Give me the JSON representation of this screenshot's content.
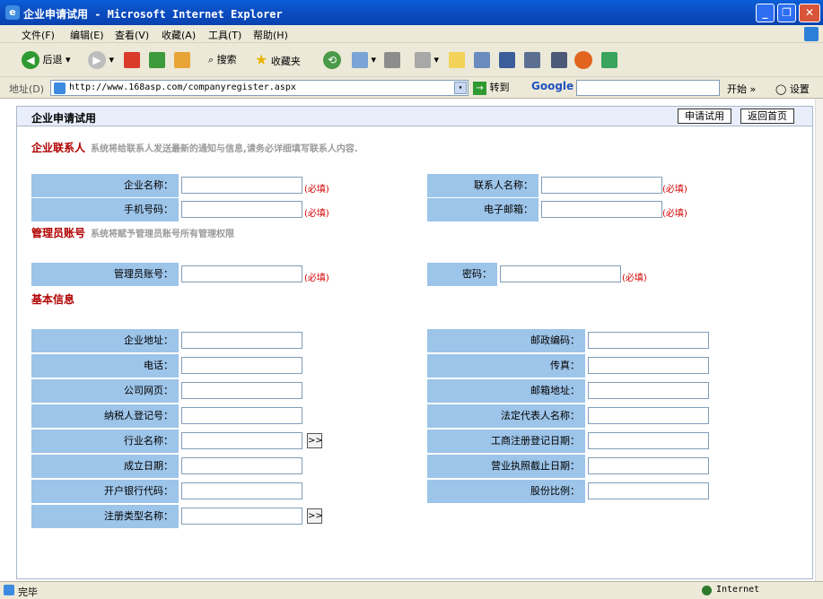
{
  "window": {
    "title": "企业申请试用 - Microsoft Internet Explorer"
  },
  "menu": [
    "文件(F)",
    "编辑(E)",
    "查看(V)",
    "收藏(A)",
    "工具(T)",
    "帮助(H)"
  ],
  "toolbar": {
    "back": "后退",
    "search": "搜索",
    "favorites": "收藏夹"
  },
  "address": {
    "label": "地址(D)",
    "url": "http://www.168asp.com/companyregister.aspx",
    "go": "转到",
    "google": "Google",
    "start": "开始",
    "settings": "设置"
  },
  "page": {
    "title": "企业申请试用",
    "apply_btn": "申请试用",
    "home_btn": "返回首页",
    "sec_contact": "企业联系人",
    "sec_contact_hint": "系统将给联系人发送最新的通知与信息,请务必详细填写联系人内容.",
    "sec_admin": "管理员账号",
    "sec_admin_hint": "系统将赋予管理员账号所有管理权限",
    "sec_basic": "基本信息",
    "required": "(必填)",
    "pick_icon": ">>",
    "f": {
      "company_name": "企业名称：",
      "contact_name": "联系人名称：",
      "mobile": "手机号码：",
      "email": "电子邮箱：",
      "admin_account": "管理员账号：",
      "password": "密码：",
      "address": "企业地址：",
      "zip": "邮政编码：",
      "phone": "电话：",
      "fax": "传真：",
      "website": "公司网页：",
      "mail_addr": "邮箱地址：",
      "tax_id": "纳税人登记号：",
      "legal_rep": "法定代表人名称：",
      "industry": "行业名称：",
      "reg_date": "工商注册登记日期：",
      "found_date": "成立日期：",
      "license_exp": "营业执照截止日期：",
      "bank_code": "开户银行代码：",
      "share": "股份比例：",
      "reg_type": "注册类型名称："
    }
  },
  "status": {
    "text": "完毕",
    "zone": "Internet"
  }
}
